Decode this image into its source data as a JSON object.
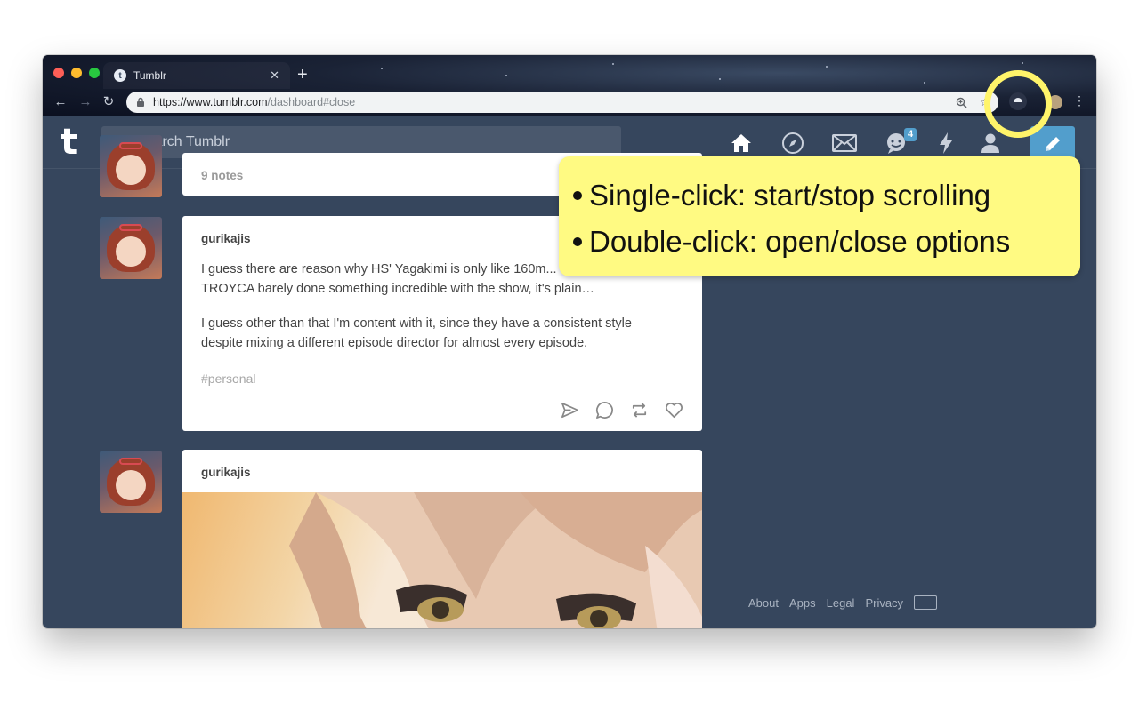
{
  "browser": {
    "tab_title": "Tumblr",
    "tab_favicon": "t",
    "url_host": "https://www.tumblr.com",
    "url_path": "/dashboard#close"
  },
  "tumblr": {
    "logo": "t",
    "search_placeholder": "Search Tumblr",
    "messages_badge": "4",
    "nav_icons": [
      "home-icon",
      "explore-icon",
      "inbox-icon",
      "messaging-icon",
      "activity-icon",
      "account-icon",
      "compose-icon"
    ]
  },
  "posts": [
    {
      "notes": "9 notes"
    },
    {
      "username": "gurikajis",
      "paragraph1_line1": "I guess there are reason why HS' Yagakimi is only like 160m...",
      "paragraph1_line2": "TROYCA barely done something incredible with the show, it's plain…",
      "paragraph2_line1": "I guess other than that I'm content with it, since they have a consistent style",
      "paragraph2_line2": "despite mixing a different episode director for almost every episode.",
      "tag": "#personal"
    },
    {
      "username": "gurikajis"
    }
  ],
  "footer": {
    "links": [
      "About",
      "Apps",
      "Legal",
      "Privacy"
    ]
  },
  "callout": {
    "line1": "Single-click: start/stop scrolling",
    "line2": "Double-click: open/close options"
  },
  "colors": {
    "tumblr_bg": "#36465d",
    "accent": "#529ecc",
    "callout_bg": "#fffa82",
    "highlight": "#fff46a"
  }
}
